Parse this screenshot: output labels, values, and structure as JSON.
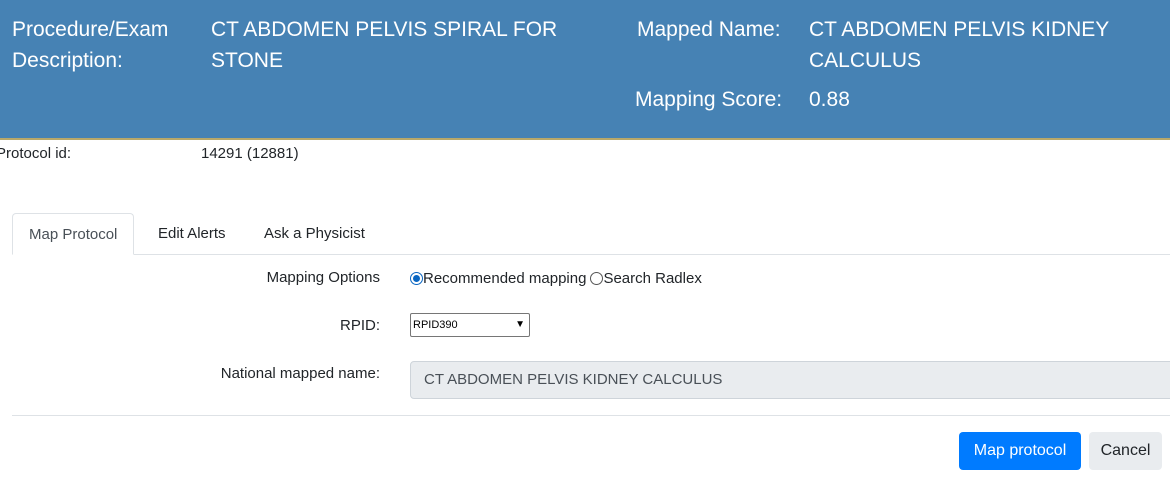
{
  "header": {
    "procedure_label_line1": "Procedure/Exam",
    "procedure_label_line2": "Description:",
    "procedure_value_line1": "CT ABDOMEN PELVIS SPIRAL FOR",
    "procedure_value_line2": "STONE",
    "mapped_name_label": "Mapped Name:",
    "mapped_name_line1": "CT ABDOMEN PELVIS KIDNEY",
    "mapped_name_line2": "CALCULUS",
    "mapping_score_label": "Mapping Score:",
    "mapping_score_value": "0.88",
    "background_color": "#4682b4"
  },
  "protocol": {
    "label": "Protocol id:",
    "value": "14291 (12881)"
  },
  "tabs": [
    {
      "label": "Map Protocol",
      "active": true
    },
    {
      "label": "Edit Alerts",
      "active": false
    },
    {
      "label": "Ask a Physicist",
      "active": false
    }
  ],
  "form": {
    "mapping_options_label": "Mapping Options",
    "radio_recommended": "Recommended mapping",
    "radio_search": "Search Radlex",
    "selected_option": "Recommended mapping",
    "rpid_label": "RPID:",
    "rpid_selected": "RPID390",
    "national_label": "National mapped name:",
    "national_value": "CT ABDOMEN PELVIS KIDNEY CALCULUS"
  },
  "buttons": {
    "map_protocol": "Map protocol",
    "cancel": "Cancel",
    "primary_color": "#007bff"
  }
}
